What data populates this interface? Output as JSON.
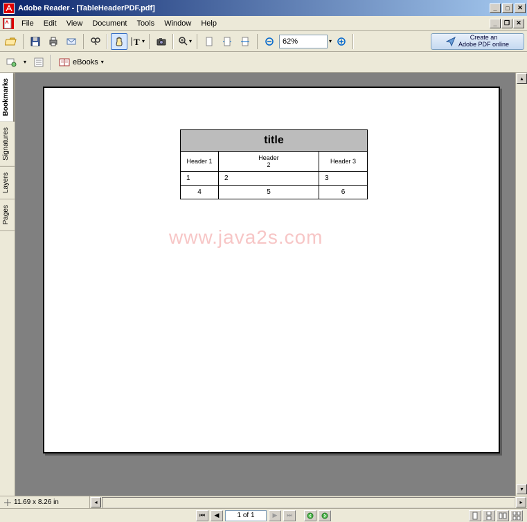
{
  "titlebar": {
    "app": "Adobe Reader",
    "doc": "[TableHeaderPDF.pdf]"
  },
  "menu": {
    "items": [
      "File",
      "Edit",
      "View",
      "Document",
      "Tools",
      "Window",
      "Help"
    ]
  },
  "toolbar": {
    "zoom": "62%",
    "adobe_online_line1": "Create an",
    "adobe_online_line2": "Adobe PDF online",
    "ebooks": "eBooks"
  },
  "sidebar": {
    "tabs": [
      "Bookmarks",
      "Signatures",
      "Layers",
      "Pages"
    ]
  },
  "document": {
    "table": {
      "title": "title",
      "headers": [
        "Header 1",
        "Header\n2",
        "Header 3"
      ],
      "rows": [
        [
          "1",
          "2",
          "3"
        ],
        [
          "4",
          "5",
          "6"
        ]
      ]
    },
    "watermark": "www.java2s.com"
  },
  "status": {
    "dimensions": "11.69 x 8.26 in",
    "page": "1 of 1"
  }
}
